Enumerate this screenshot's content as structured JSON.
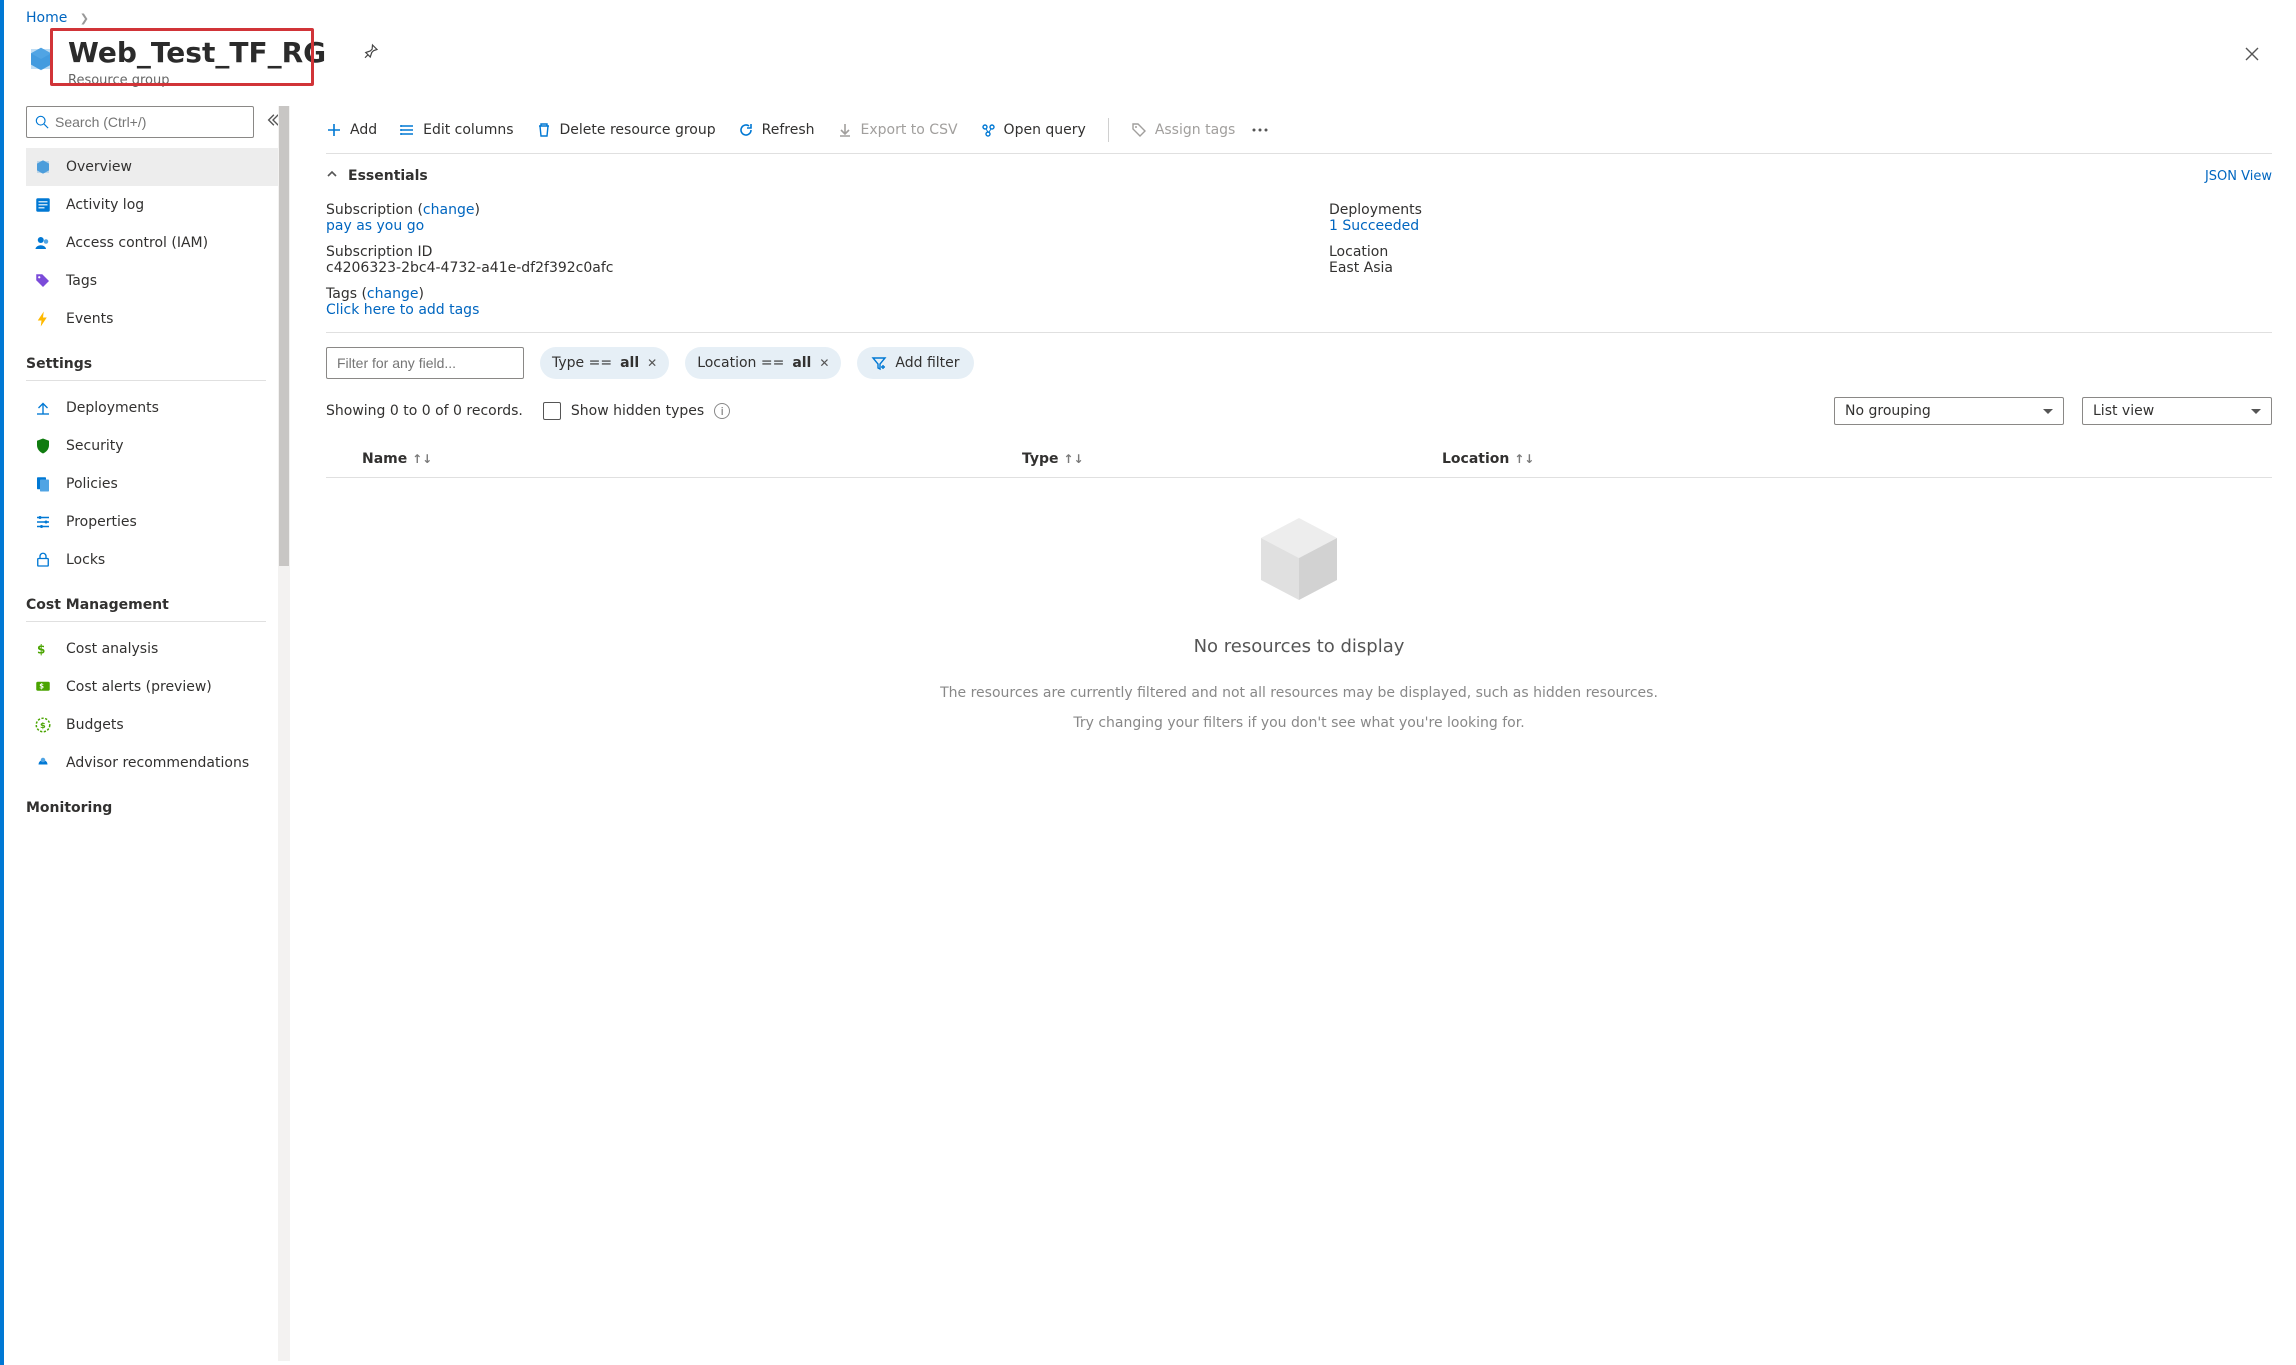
{
  "breadcrumb": {
    "home": "Home"
  },
  "header": {
    "title": "Web_Test_TF_RG",
    "subtitle": "Resource group"
  },
  "search": {
    "placeholder": "Search (Ctrl+/)"
  },
  "sidebar": {
    "overview": "Overview",
    "activity_log": "Activity log",
    "iam": "Access control (IAM)",
    "tags": "Tags",
    "events": "Events",
    "group_settings": "Settings",
    "deployments": "Deployments",
    "security": "Security",
    "policies": "Policies",
    "properties": "Properties",
    "locks": "Locks",
    "group_cost": "Cost Management",
    "cost_analysis": "Cost analysis",
    "cost_alerts": "Cost alerts (preview)",
    "budgets": "Budgets",
    "advisor": "Advisor recommendations",
    "group_monitoring": "Monitoring"
  },
  "toolbar": {
    "add": "Add",
    "edit_columns": "Edit columns",
    "delete_group": "Delete resource group",
    "refresh": "Refresh",
    "export_csv": "Export to CSV",
    "open_query": "Open query",
    "assign_tags": "Assign tags"
  },
  "essentials": {
    "label": "Essentials",
    "json_view": "JSON View",
    "subscription_label": "Subscription",
    "change": "change",
    "subscription_value": "pay as you go",
    "deployments_label": "Deployments",
    "deployments_value": "1 Succeeded",
    "subscription_id_label": "Subscription ID",
    "subscription_id_value": "c4206323-2bc4-4732-a41e-df2f392c0afc",
    "location_label": "Location",
    "location_value": "East Asia",
    "tags_label": "Tags",
    "tags_link": "Click here to add tags"
  },
  "filters": {
    "filter_placeholder": "Filter for any field...",
    "type_prefix": "Type == ",
    "type_value": "all",
    "location_prefix": "Location == ",
    "location_value": "all",
    "add_filter": "Add filter",
    "showing": "Showing 0 to 0 of 0 records.",
    "show_hidden": "Show hidden types",
    "no_grouping": "No grouping",
    "list_view": "List view"
  },
  "columns": {
    "name": "Name",
    "type": "Type",
    "location": "Location"
  },
  "empty": {
    "title": "No resources to display",
    "line1": "The resources are currently filtered and not all resources may be displayed, such as hidden resources.",
    "line2": "Try changing your filters if you don't see what you're looking for."
  }
}
